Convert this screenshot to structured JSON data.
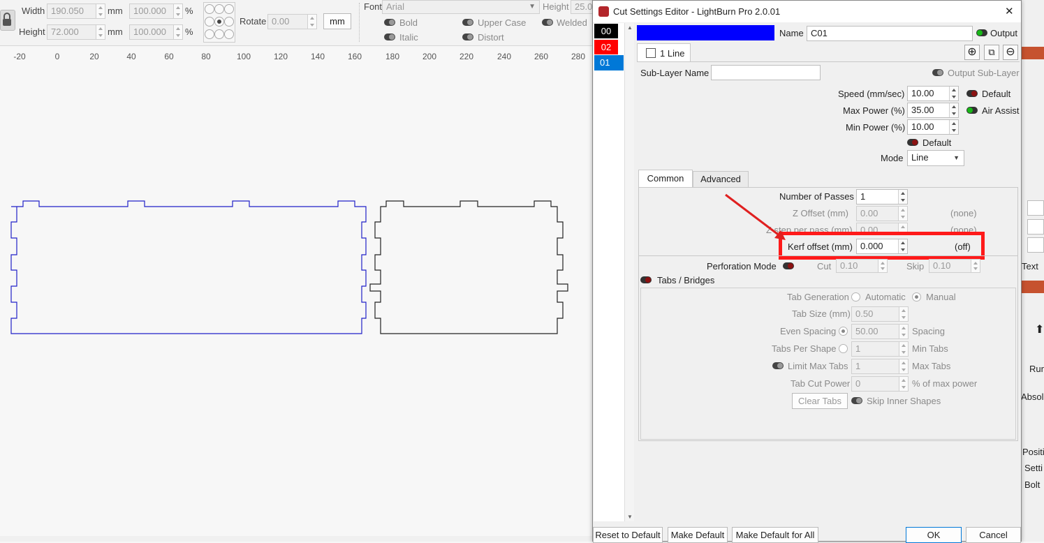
{
  "toolbar": {
    "width_label": "Width",
    "width_value": "190.050",
    "width_unit": "mm",
    "width_pct": "100.000",
    "pct": "%",
    "height_label": "Height",
    "height_value": "72.000",
    "height_unit": "mm",
    "height_pct": "100.000",
    "rotate_label": "Rotate",
    "rotate_value": "0.00",
    "units_button": "mm",
    "font_label": "Font",
    "font_value": "Arial",
    "bold": "Bold",
    "italic": "Italic",
    "upper_case": "Upper Case",
    "distort": "Distort",
    "text_height_label": "Height",
    "text_height_value": "25.0",
    "welded": "Welded"
  },
  "ruler": {
    "ticks": [
      "-20",
      "0",
      "20",
      "40",
      "60",
      "80",
      "100",
      "120",
      "140",
      "160",
      "180",
      "200",
      "220",
      "240",
      "260",
      "280"
    ]
  },
  "right_panel": {
    "text_tab": "Text",
    "run": "Run",
    "absol": "Absol",
    "posit": "Positi",
    "setti": "Setti",
    "bolt": "Bolt",
    "arrow": "⬆"
  },
  "dialog": {
    "title": "Cut Settings Editor - LightBurn Pro 2.0.01",
    "close": "✕",
    "layers": [
      {
        "label": "00",
        "color": "#000000"
      },
      {
        "label": "02",
        "color": "#ff0000"
      },
      {
        "label": "01",
        "color": "#0055ff"
      }
    ],
    "layer_color": "#0000ff",
    "name_label": "Name",
    "name_value": "C01",
    "output_label": "Output",
    "sublayer_tab": "1 Line",
    "sublayer_name_label": "Sub-Layer Name",
    "sublayer_name_value": "",
    "output_sublayer_label": "Output Sub-Layer",
    "speed_label": "Speed (mm/sec)",
    "speed_value": "10.00",
    "default_label": "Default",
    "max_power_label": "Max Power (%)",
    "max_power_value": "35.00",
    "air_assist_label": "Air Assist",
    "min_power_label": "Min Power (%)",
    "min_power_value": "10.00",
    "default2_label": "Default",
    "mode_label": "Mode",
    "mode_value": "Line",
    "tabs": [
      "Common",
      "Advanced"
    ],
    "passes_label": "Number of Passes",
    "passes_value": "1",
    "z_offset_label": "Z Offset (mm)",
    "z_offset_value": "0.00",
    "z_offset_note": "(none)",
    "z_step_label": "Z step per pass (mm)",
    "z_step_value": "0.00",
    "z_step_note": "(none)",
    "kerf_label": "Kerf offset (mm)",
    "kerf_value": "0.000",
    "kerf_note": "(off)",
    "perforation_label": "Perforation Mode",
    "cut_label": "Cut",
    "cut_value": "0.10",
    "skip_label": "Skip",
    "skip_value": "0.10",
    "tabs_bridges_label": "Tabs / Bridges",
    "tab_generation_label": "Tab Generation",
    "automatic": "Automatic",
    "manual": "Manual",
    "tab_size_label": "Tab Size (mm)",
    "tab_size_value": "0.50",
    "even_spacing_label": "Even Spacing",
    "even_spacing_value": "50.00",
    "spacing_label": "Spacing",
    "tabs_per_shape_label": "Tabs Per Shape",
    "tabs_per_shape_value": "1",
    "min_tabs_label": "Min Tabs",
    "limit_max_tabs_label": "Limit Max Tabs",
    "limit_max_tabs_value": "1",
    "max_tabs_label": "Max Tabs",
    "tab_cut_power_label": "Tab Cut Power",
    "tab_cut_power_value": "0",
    "pct_max_power_label": "% of max power",
    "clear_tabs": "Clear Tabs",
    "skip_inner_label": "Skip Inner Shapes",
    "reset_default": "Reset to Default",
    "make_default": "Make Default",
    "make_default_all": "Make Default for All",
    "ok": "OK",
    "cancel": "Cancel"
  },
  "colors": {
    "accent_red": "#ff0000",
    "selected_blue": "#0078d7",
    "layer_blue": "#0000ff"
  }
}
